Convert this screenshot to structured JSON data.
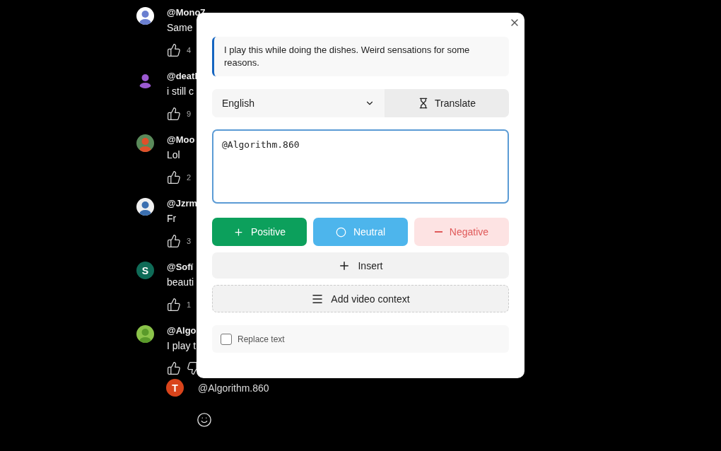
{
  "comments": [
    {
      "author": "@Mono7",
      "text": "Same",
      "likes": "4"
    },
    {
      "author": "@deatl",
      "text": "i still c",
      "likes": "9"
    },
    {
      "author": "@Moo",
      "text": "Lol",
      "likes": "2"
    },
    {
      "author": "@Jzrm",
      "text": "Fr",
      "likes": "3"
    },
    {
      "letter": "S",
      "color": "#0f6b57",
      "author": "@Sofí",
      "text": "beauti",
      "likes": "1"
    },
    {
      "author": "@Algo",
      "text": "I play t",
      "dislike": true
    }
  ],
  "reply": {
    "letter": "T",
    "color": "#d9441b",
    "value": "@Algorithm.860"
  },
  "dialog": {
    "quote": "I play this while doing the dishes. Weird sensations for some reasons.",
    "language": "English",
    "translate": "Translate",
    "draft": "@Algorithm.860",
    "tones": [
      {
        "kind": "positive",
        "label": "Positive"
      },
      {
        "kind": "neutral",
        "label": "Neutral"
      },
      {
        "kind": "negative",
        "label": "Negative"
      }
    ],
    "insert": "Insert",
    "context": "Add video context",
    "replace": {
      "label": "Replace text",
      "checked": false
    }
  }
}
